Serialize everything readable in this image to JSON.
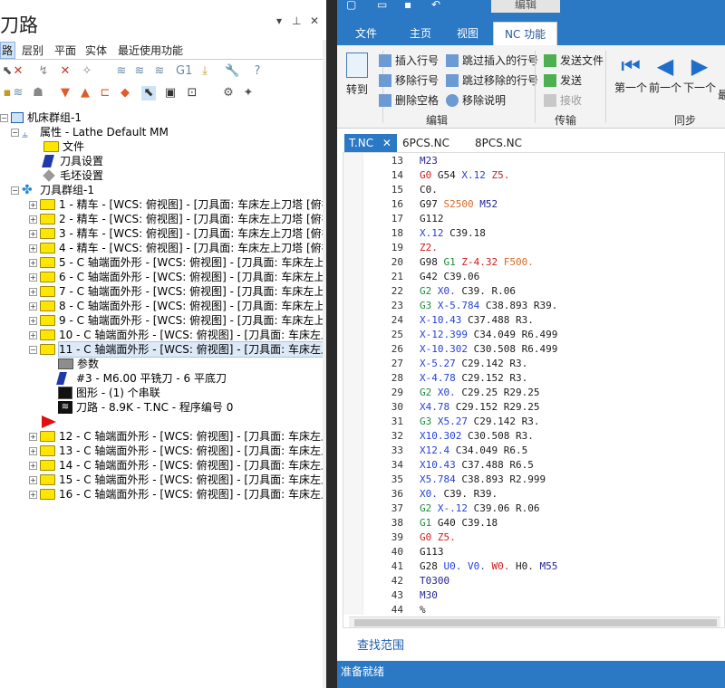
{
  "left_panel": {
    "title": "刀路",
    "pin_glyph": "▾  ⊥  ✕",
    "tabs": [
      "路",
      "层别",
      "平面",
      "实体",
      "最近使用功能"
    ],
    "tree": {
      "machine_group": "机床群组-1",
      "properties": "属性 - Lathe Default MM",
      "file": "文件",
      "tool_settings": "刀具设置",
      "stock_settings": "毛坯设置",
      "toolpath_group": "刀具群组-1",
      "ops": [
        "1 - 精车 - [WCS: 俯视图] - [刀具面: 车床左上刀塔 [俯视",
        "2 - 精车 - [WCS: 俯视图] - [刀具面: 车床左上刀塔 [俯视",
        "3 - 精车 - [WCS: 俯视图] - [刀具面: 车床左上刀塔 [俯视",
        "4 - 精车 - [WCS: 俯视图] - [刀具面: 车床左上刀塔 [俯视",
        "5 - C 轴端面外形 - [WCS: 俯视图] - [刀具面: 车床左上刀",
        "6 - C 轴端面外形 - [WCS: 俯视图] - [刀具面: 车床左上刀",
        "7 - C 轴端面外形 - [WCS: 俯视图] - [刀具面: 车床左上刀",
        "8 - C 轴端面外形 - [WCS: 俯视图] - [刀具面: 车床左上刀",
        "9 - C 轴端面外形 - [WCS: 俯视图] - [刀具面: 车床左上刀",
        "10 - C 轴端面外形 - [WCS: 俯视图] - [刀具面: 车床左上刀",
        "11 - C 轴端面外形 - [WCS: 俯视图] - [刀具面: 车床左上刀"
      ],
      "op11_children": {
        "params": "参数",
        "tool": "#3 - M6.00 平铣刀 - 6 平底刀",
        "geometry": "图形 - (1) 个串联",
        "toolpath": "刀路 - 8.9K - T.NC - 程序编号 0"
      },
      "ops_after": [
        "12 - C 轴端面外形 - [WCS: 俯视图] - [刀具面: 车床左上刀",
        "13 - C 轴端面外形 - [WCS: 俯视图] - [刀具面: 车床左上刀",
        "14 - C 轴端面外形 - [WCS: 俯视图] - [刀具面: 车床左上刀",
        "15 - C 轴端面外形 - [WCS: 俯视图] - [刀具面: 车床左上刀",
        "16 - C 轴端面外形 - [WCS: 俯视图] - [刀具面: 车床左上刀"
      ]
    }
  },
  "ribbon": {
    "context_tab": "编辑",
    "tabs": [
      "文件",
      "主页",
      "视图",
      "NC 功能"
    ],
    "goto": "转到",
    "insert_line": "插入行号",
    "move_line": "移除行号",
    "remove_spaces": "删除空格",
    "skip_insert": "跳过插入的行号",
    "skip_remove": "跳过移除的行号",
    "remove_comments": "移除说明",
    "send_file": "发送文件",
    "send": "发送",
    "receive": "接收",
    "first": "第一个",
    "prev": "前一个",
    "next": "下一个",
    "next_more": "最",
    "group_edit": "编辑",
    "group_transfer": "传输",
    "group_sync": "同步"
  },
  "file_tabs": [
    "T.NC",
    "6PCS.NC",
    "8PCS.NC"
  ],
  "code_lines": [
    {
      "n": "13",
      "t": "M23"
    },
    {
      "n": "14",
      "t": "G0 G54 X.12 Z5."
    },
    {
      "n": "15",
      "t": "C0."
    },
    {
      "n": "16",
      "t": "G97 S2500 M52"
    },
    {
      "n": "17",
      "t": "G112"
    },
    {
      "n": "18",
      "t": "X.12 C39.18"
    },
    {
      "n": "19",
      "t": "Z2."
    },
    {
      "n": "20",
      "t": "G98 G1 Z-4.32 F500."
    },
    {
      "n": "21",
      "t": "G42 C39.06"
    },
    {
      "n": "22",
      "t": "G2 X0. C39. R.06"
    },
    {
      "n": "23",
      "t": "G3 X-5.784 C38.893 R39."
    },
    {
      "n": "24",
      "t": "X-10.43 C37.488 R3."
    },
    {
      "n": "25",
      "t": "X-12.399 C34.049 R6.499"
    },
    {
      "n": "26",
      "t": "X-10.302 C30.508 R6.499"
    },
    {
      "n": "27",
      "t": "X-5.27 C29.142 R3."
    },
    {
      "n": "28",
      "t": "X-4.78 C29.152 R3."
    },
    {
      "n": "29",
      "t": "G2 X0. C29.25 R29.25"
    },
    {
      "n": "30",
      "t": "X4.78 C29.152 R29.25"
    },
    {
      "n": "31",
      "t": "G3 X5.27 C29.142 R3."
    },
    {
      "n": "32",
      "t": "X10.302 C30.508 R3."
    },
    {
      "n": "33",
      "t": "X12.4 C34.049 R6.5"
    },
    {
      "n": "34",
      "t": "X10.43 C37.488 R6.5"
    },
    {
      "n": "35",
      "t": "X5.784 C38.893 R2.999"
    },
    {
      "n": "36",
      "t": "X0. C39. R39."
    },
    {
      "n": "37",
      "t": "G2 X-.12 C39.06 R.06"
    },
    {
      "n": "38",
      "t": "G1 G40 C39.18"
    },
    {
      "n": "39",
      "t": "G0 Z5."
    },
    {
      "n": "40",
      "t": "G113"
    },
    {
      "n": "41",
      "t": "G28 U0. V0. W0. H0. M55"
    },
    {
      "n": "42",
      "t": "T0300"
    },
    {
      "n": "43",
      "t": "M30"
    },
    {
      "n": "44",
      "t": "%"
    }
  ],
  "find_link": "查找范围",
  "status": "准备就绪",
  "colors": {
    "accent": "#2b79c5",
    "folder": "#ffe600"
  }
}
